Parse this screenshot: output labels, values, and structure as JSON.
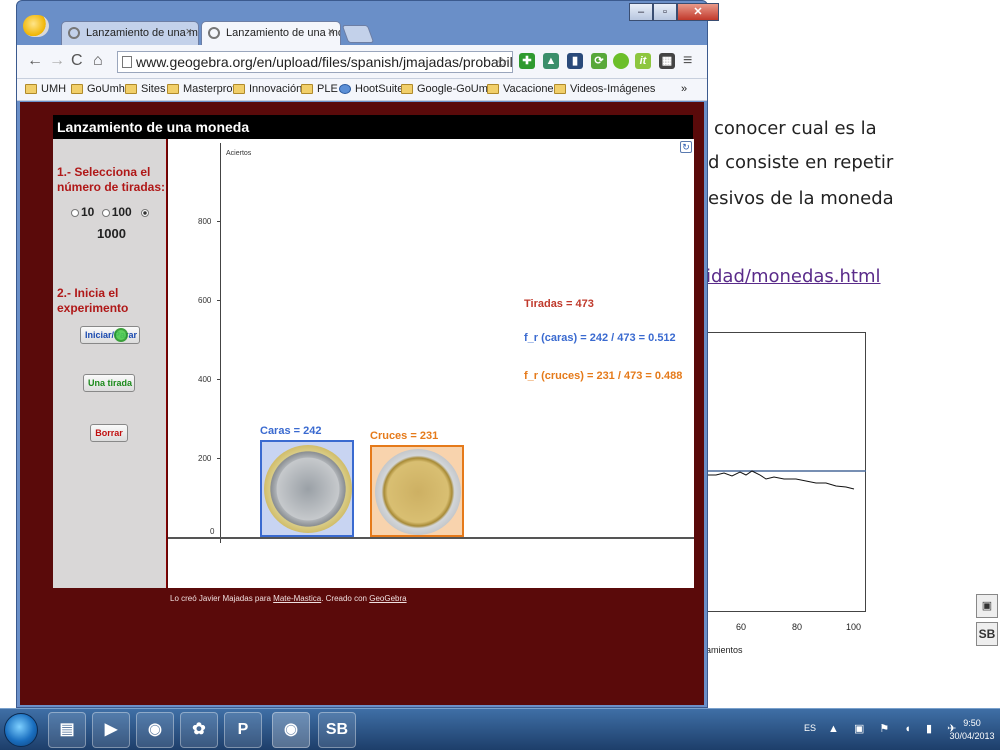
{
  "background_doc": {
    "lines": [
      "conocer cual es la",
      "d consiste en repetir",
      "esivos de la moneda"
    ],
    "link": "idad/monedas.html",
    "ticks": [
      "60",
      "80",
      "100"
    ],
    "axis_label": "amientos"
  },
  "side_widget": {
    "label": "SB"
  },
  "browser": {
    "tabs": [
      {
        "label": "Lanzamiento de una mon"
      },
      {
        "label": "Lanzamiento de una mone"
      }
    ],
    "tab_close": "×",
    "window_buttons": {
      "minimize": "–",
      "maximize": "▫",
      "close": "✕"
    },
    "url": "www.geogebra.org/en/upload/files/spanish/jmajadas/probabilidad/monedas.html",
    "bookmarks": [
      "UMH",
      "GoUmh",
      "Sites",
      "Masterprof",
      "Innovación",
      "PLE",
      "HootSuite",
      "Google-GoUmh",
      "Vacaciones",
      "Videos-Imágenes"
    ],
    "more": "»"
  },
  "app": {
    "title": "Lanzamiento de una moneda",
    "step1": "1.- Selecciona el número de tiradas:",
    "radios": [
      "10",
      "100",
      "1000"
    ],
    "selected": "1000",
    "step2": "2.- Inicia el experimento",
    "btn_iniciar": "Iniciar/Parar",
    "btn_una": "Una tirada",
    "btn_borrar": "Borrar",
    "y_axis_label": "Aciertos",
    "y_ticks": [
      "800",
      "600",
      "400",
      "200",
      "0"
    ],
    "caras_label": "Caras = 242",
    "cruces_label": "Cruces = 231",
    "tiradas": "Tiradas = 473",
    "fr_caras": "f_r (caras) = 242 / 473 = 0.512",
    "fr_cruces": "f_r (cruces) = 231 / 473 = 0.488",
    "credit_prefix": "Lo creó Javier Majadas para ",
    "credit_link1": "Mate-Mastica",
    "credit_mid": ". Creado con ",
    "credit_link2": "GeoGebra"
  },
  "taskbar": {
    "lang": "ES",
    "time": "9:50",
    "date": "30/04/2013",
    "sb_label": "SB"
  },
  "colors": {
    "caras": "#3a6ad0",
    "cruces": "#e57a1a",
    "tiradas": "#c0392b",
    "frame": "#5a0a0a"
  }
}
